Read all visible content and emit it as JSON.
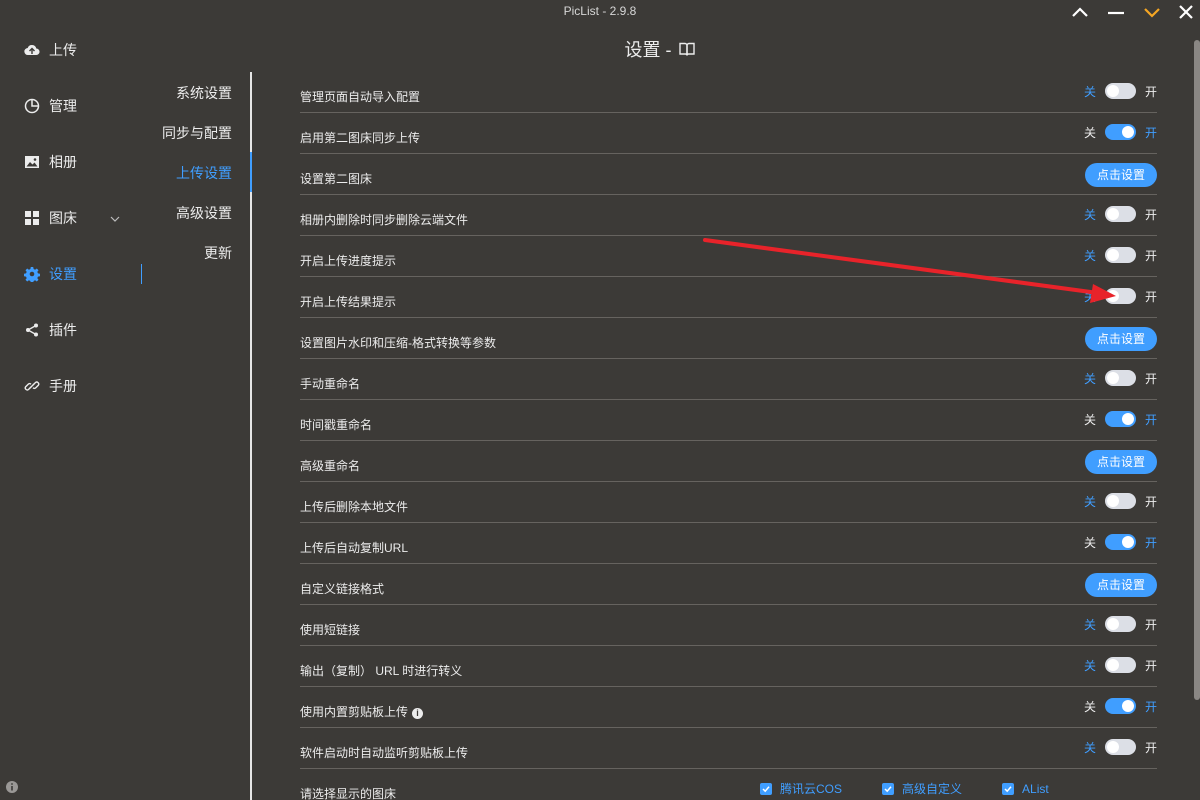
{
  "window": {
    "title": "PicList - 2.9.8",
    "buttons": [
      "chevron-up-icon",
      "minimize-icon",
      "chevron-down-icon",
      "close-icon"
    ],
    "accent_color": "#409eff",
    "minimize_down_color": "#f5a623"
  },
  "sidebar": {
    "items": [
      {
        "label": "上传",
        "icon": "cloud-upload-icon"
      },
      {
        "label": "管理",
        "icon": "pie-chart-icon"
      },
      {
        "label": "相册",
        "icon": "image-icon"
      },
      {
        "label": "图床",
        "icon": "grid-icon"
      },
      {
        "label": "设置",
        "icon": "gear-icon",
        "active": true
      },
      {
        "label": "插件",
        "icon": "share-icon"
      },
      {
        "label": "手册",
        "icon": "link-icon"
      }
    ]
  },
  "page": {
    "title": "设置 -"
  },
  "subnav": {
    "items": [
      "系统设置",
      "同步与配置",
      "上传设置",
      "高级设置",
      "更新"
    ],
    "active": "上传设置"
  },
  "switch_labels": {
    "off": "关",
    "on": "开"
  },
  "settings": [
    {
      "label": "管理页面自动导入配置",
      "type": "switch",
      "on": false
    },
    {
      "label": "启用第二图床同步上传",
      "type": "switch",
      "on": true
    },
    {
      "label": "设置第二图床",
      "type": "button",
      "button": "点击设置"
    },
    {
      "label": "相册内删除时同步删除云端文件",
      "type": "switch",
      "on": false
    },
    {
      "label": "开启上传进度提示",
      "type": "switch",
      "on": false
    },
    {
      "label": "开启上传结果提示",
      "type": "switch",
      "on": false
    },
    {
      "label": "设置图片水印和压缩-格式转换等参数",
      "type": "button",
      "button": "点击设置"
    },
    {
      "label": "手动重命名",
      "type": "switch",
      "on": false
    },
    {
      "label": "时间戳重命名",
      "type": "switch",
      "on": true
    },
    {
      "label": "高级重命名",
      "type": "button",
      "button": "点击设置"
    },
    {
      "label": "上传后删除本地文件",
      "type": "switch",
      "on": false
    },
    {
      "label": "上传后自动复制URL",
      "type": "switch",
      "on": true
    },
    {
      "label": "自定义链接格式",
      "type": "button",
      "button": "点击设置"
    },
    {
      "label": "使用短链接",
      "type": "switch",
      "on": false
    },
    {
      "label": "输出（复制） URL 时进行转义",
      "type": "switch",
      "on": false
    },
    {
      "label": "使用内置剪贴板上传",
      "type": "switch",
      "on": true,
      "info": "i"
    },
    {
      "label": "软件启动时自动监听剪贴板上传",
      "type": "switch",
      "on": false
    },
    {
      "label": "请选择显示的图床",
      "type": "checks",
      "options": [
        "腾讯云COS",
        "高级自定义",
        "AList"
      ]
    }
  ]
}
